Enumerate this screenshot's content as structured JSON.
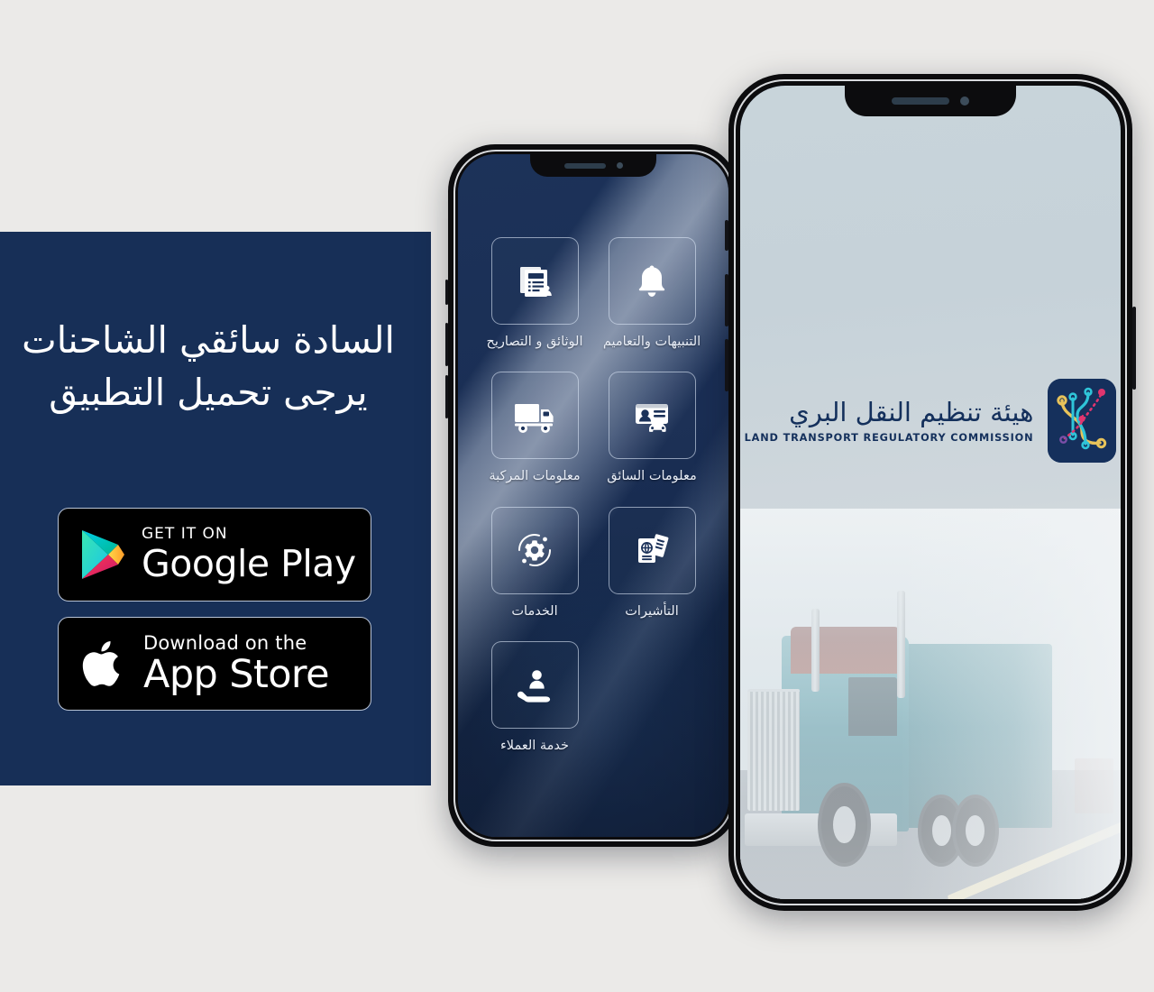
{
  "page": {
    "background_color": "#ebeae8",
    "banner_color": "#172f57",
    "brand_navy": "#14305c"
  },
  "banner": {
    "headline_line1": "السادة سائقي الشاحنات",
    "headline_line2": "يرجى تحميل التطبيق",
    "badges": [
      {
        "id": "google-play",
        "icon": "google-play-icon",
        "small_label": "GET IT ON",
        "big_label": "Google Play"
      },
      {
        "id": "app-store",
        "icon": "apple-logo-icon",
        "small_label": "Download on the",
        "big_label": "App Store"
      }
    ]
  },
  "back_phone": {
    "screen_name": "app-home-menu",
    "tiles": [
      {
        "label": "التنبيهات والتعاميم",
        "icon": "bell-icon"
      },
      {
        "label": "الوثائق و التصاريح",
        "icon": "documents-icon"
      },
      {
        "label": "معلومات السائق",
        "icon": "driver-card-icon"
      },
      {
        "label": "معلومات المركبة",
        "icon": "truck-icon"
      },
      {
        "label": "التأشيرات",
        "icon": "passport-icon"
      },
      {
        "label": "الخدمات",
        "icon": "gear-icon"
      },
      {
        "label": "خدمة العملاء",
        "icon": "customer-service-icon"
      }
    ]
  },
  "front_phone": {
    "screen_name": "app-splash-screen",
    "brand_ar": "هيئة تنظيم النقل البري",
    "brand_en": "LAND TRANSPORT REGULATORY COMMISSION",
    "logo_icon": "ltrc-route-logo-icon",
    "logo_colors": {
      "background": "#15305c",
      "yellow": "#e8c35a",
      "cyan": "#2fc4d8",
      "magenta": "#e0356f",
      "purple": "#7b4fa8"
    },
    "photo": "teal-semi-truck-on-highway"
  }
}
